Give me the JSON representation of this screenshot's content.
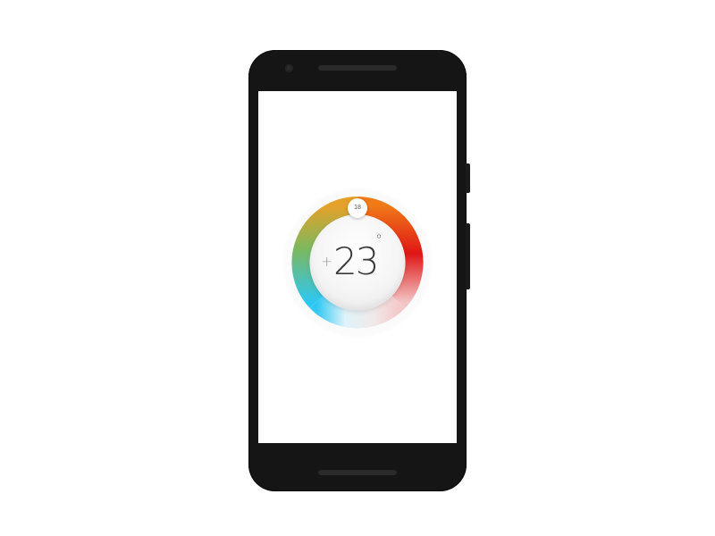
{
  "thermostat": {
    "current_temperature": "23",
    "degree_symbol": "°",
    "increase_symbol": "+",
    "set_point": "18"
  },
  "icons": {
    "increase": "plus-icon"
  },
  "colors": {
    "ring_cold": "#29c6f0",
    "ring_cool": "#7cbf5a",
    "ring_warm": "#f0a020",
    "ring_orange": "#f26a1a",
    "ring_hot": "#e01818",
    "phone_body": "#151515",
    "screen_background": "#ffffff"
  }
}
